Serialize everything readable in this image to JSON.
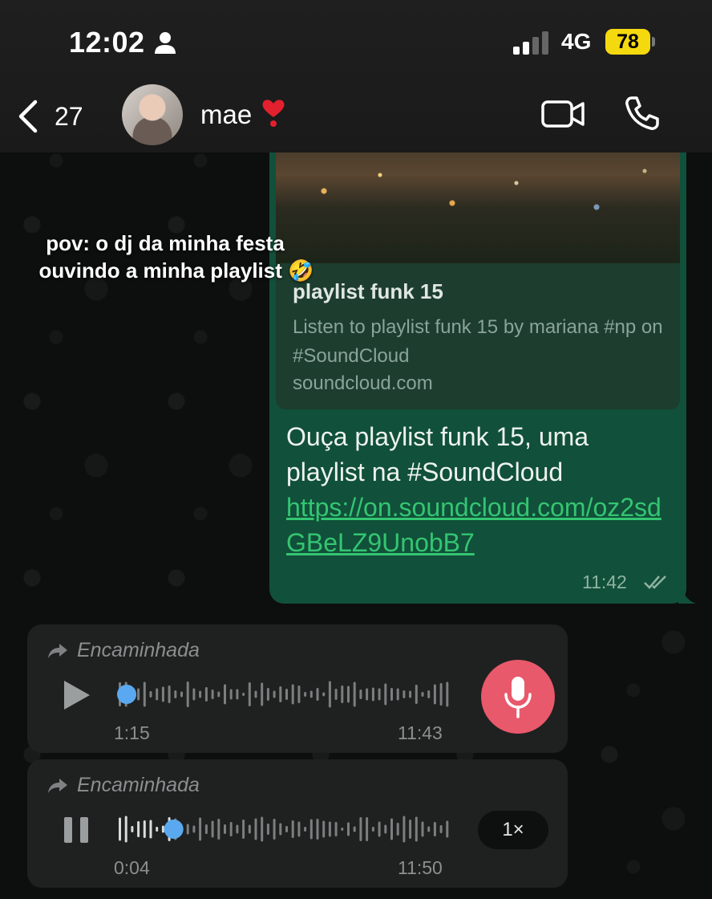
{
  "status_bar": {
    "time": "12:02",
    "network": "4G",
    "battery": "78",
    "battery_color": "#f5d90f"
  },
  "header": {
    "back_count": "27",
    "contact_name": "mae",
    "contact_emoji": "heart-exclamation-icon"
  },
  "caption": {
    "line1": "pov: o dj da minha festa",
    "line2": "ouvindo a minha playlist 🤣"
  },
  "outgoing_message": {
    "link_preview": {
      "title": "playlist funk 15",
      "description": "Listen to playlist funk 15 by mariana #np on #SoundCloud",
      "domain": "soundcloud.com"
    },
    "text": "Ouça playlist funk 15, uma playlist na #SoundCloud",
    "link": "https://on.soundcloud.com/oz2sdGBeLZ9UnobB7",
    "time": "11:42",
    "bubble_color": "#11503a",
    "link_color": "#34c572"
  },
  "voice_messages": [
    {
      "forwarded_label": "Encaminhada",
      "duration": "1:15",
      "time": "11:43",
      "progress": 0.0,
      "state": "paused"
    },
    {
      "forwarded_label": "Encaminhada",
      "duration": "0:04",
      "time": "11:50",
      "progress": 0.17,
      "state": "playing",
      "speed": "1×"
    }
  ],
  "mic_color": "#e8596b"
}
